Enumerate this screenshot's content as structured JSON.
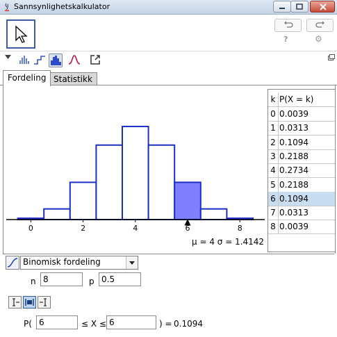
{
  "window": {
    "title": "Sannsynlighetskalkulator"
  },
  "toolbar": {
    "help": "?",
    "settings": "⚙"
  },
  "tabs": [
    {
      "label": "Fordeling"
    },
    {
      "label": "Statistikk"
    }
  ],
  "plot": {
    "stats": "μ = 4   σ = 1.4142",
    "selected_k": 6,
    "fill_color": "#8080ff",
    "stroke_color": "#1c2fc4",
    "marker": "▲"
  },
  "chart_data": {
    "type": "bar",
    "x": [
      0,
      1,
      2,
      3,
      4,
      5,
      6,
      7,
      8
    ],
    "values": [
      0.0039,
      0.0313,
      0.1094,
      0.2188,
      0.2734,
      0.2188,
      0.1094,
      0.0313,
      0.0039
    ],
    "tick_labels": [
      "0",
      "2",
      "4",
      "6",
      "8"
    ],
    "highlight": [
      6
    ],
    "xlim": [
      -1,
      8.6
    ],
    "ylim": [
      0,
      0.3
    ]
  },
  "table": {
    "headers": [
      "k",
      "P(X = k)"
    ],
    "rows": [
      [
        "0",
        "0.0039"
      ],
      [
        "1",
        "0.0313"
      ],
      [
        "2",
        "0.1094"
      ],
      [
        "3",
        "0.2188"
      ],
      [
        "4",
        "0.2734"
      ],
      [
        "5",
        "0.2188"
      ],
      [
        "6",
        "0.1094"
      ],
      [
        "7",
        "0.0313"
      ],
      [
        "8",
        "0.0039"
      ]
    ],
    "selected_row": 6
  },
  "distribution": {
    "selected": "Binomisk fordeling"
  },
  "params": {
    "n_label": "n",
    "n_value": "8",
    "p_label": "p",
    "p_value": "0.5"
  },
  "interval": {
    "p_open": "P(",
    "lower": "6",
    "middle": "≤ X ≤",
    "upper": "6",
    "result_prefix": ") =",
    "result": "0.1094"
  }
}
